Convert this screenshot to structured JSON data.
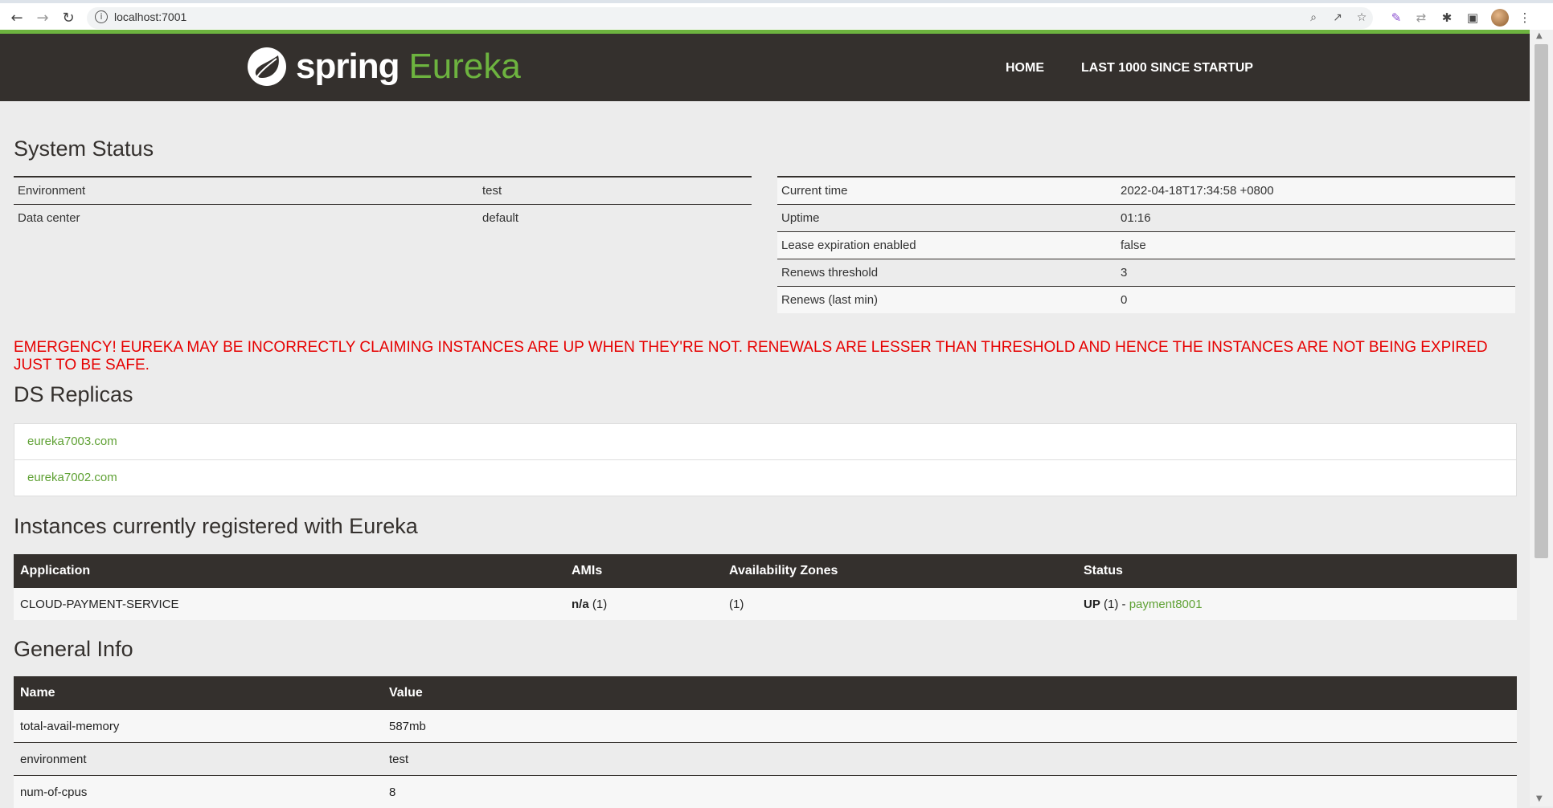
{
  "browser": {
    "url": "localhost:7001"
  },
  "header": {
    "logo_spring": "spring",
    "logo_eureka": "Eureka",
    "nav": [
      "HOME",
      "LAST 1000 SINCE STARTUP"
    ]
  },
  "system_status": {
    "title": "System Status",
    "left": [
      {
        "label": "Environment",
        "value": "test"
      },
      {
        "label": "Data center",
        "value": "default"
      }
    ],
    "right": [
      {
        "label": "Current time",
        "value": "2022-04-18T17:34:58 +0800"
      },
      {
        "label": "Uptime",
        "value": "01:16"
      },
      {
        "label": "Lease expiration enabled",
        "value": "false"
      },
      {
        "label": "Renews threshold",
        "value": "3"
      },
      {
        "label": "Renews (last min)",
        "value": "0"
      }
    ]
  },
  "emergency": "EMERGENCY! EUREKA MAY BE INCORRECTLY CLAIMING INSTANCES ARE UP WHEN THEY'RE NOT. RENEWALS ARE LESSER THAN THRESHOLD AND HENCE THE INSTANCES ARE NOT BEING EXPIRED JUST TO BE SAFE.",
  "ds_replicas": {
    "title": "DS Replicas",
    "items": [
      "eureka7003.com",
      "eureka7002.com"
    ]
  },
  "instances": {
    "title": "Instances currently registered with Eureka",
    "headers": [
      "Application",
      "AMIs",
      "Availability Zones",
      "Status"
    ],
    "rows": [
      {
        "application": "CLOUD-PAYMENT-SERVICE",
        "amis_bold": "n/a",
        "amis_count": " (1)",
        "zones": "(1)",
        "status_up": "UP",
        "status_rest": " (1) - ",
        "instance_link": "payment8001"
      }
    ]
  },
  "general_info": {
    "title": "General Info",
    "headers": [
      "Name",
      "Value"
    ],
    "rows": [
      {
        "name": "total-avail-memory",
        "value": "587mb"
      },
      {
        "name": "environment",
        "value": "test"
      },
      {
        "name": "num-of-cpus",
        "value": "8"
      }
    ]
  },
  "colors": {
    "brand_green": "#6db33f",
    "header_dark": "#34302d",
    "emergency_red": "#e60000"
  }
}
